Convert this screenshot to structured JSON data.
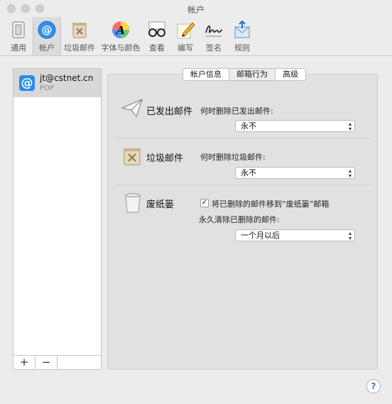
{
  "window": {
    "title": "帐户"
  },
  "toolbar": {
    "items": [
      {
        "label": "通用",
        "icon": "switch-icon"
      },
      {
        "label": "帐户",
        "icon": "at-icon"
      },
      {
        "label": "垃圾邮件",
        "icon": "junk-bin-icon"
      },
      {
        "label": "字体与颜色",
        "icon": "font-icon"
      },
      {
        "label": "查看",
        "icon": "glasses-icon"
      },
      {
        "label": "编写",
        "icon": "pencil-icon"
      },
      {
        "label": "签名",
        "icon": "signature-icon"
      },
      {
        "label": "规则",
        "icon": "rules-icon"
      }
    ],
    "selected": "帐户"
  },
  "accounts": [
    {
      "name": "jt@cstnet.cn",
      "type": "POP"
    }
  ],
  "account_list_buttons": {
    "add": "+",
    "remove": "−"
  },
  "tabs": [
    {
      "label": "帐户信息"
    },
    {
      "label": "邮箱行为"
    },
    {
      "label": "高级"
    }
  ],
  "sections": {
    "sent": {
      "title": "已发出邮件",
      "question": "何时删除已发出邮件:",
      "value": "永不"
    },
    "junk": {
      "title": "垃圾邮件",
      "question": "何时删除垃圾邮件:",
      "value": "永不"
    },
    "trash": {
      "title": "废纸篓",
      "checkbox_label": "将已删除的邮件移到“废纸篓”邮箱",
      "checkbox_checked": true,
      "question": "永久清除已删除的邮件:",
      "value": "一个月以后"
    }
  },
  "help": "?"
}
